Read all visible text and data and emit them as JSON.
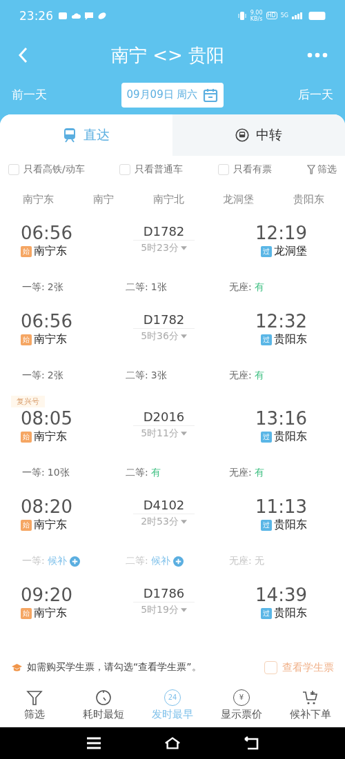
{
  "status_bar": {
    "time": "23:26",
    "speed": "9.00",
    "speed_unit": "KB/s",
    "hd": "HD",
    "network": "5G"
  },
  "header": {
    "title": "南宁 <> 贵阳",
    "prev_day": "前一天",
    "date": "09月09日 周六",
    "next_day": "后一天"
  },
  "tabs": [
    {
      "label": "直达",
      "kind": "direct",
      "selected": true
    },
    {
      "label": "中转",
      "kind": "transfer",
      "selected": false
    }
  ],
  "filters": [
    {
      "label": "只看高铁/动车",
      "checked": false
    },
    {
      "label": "只看普通车",
      "checked": false
    },
    {
      "label": "只看有票",
      "checked": false
    }
  ],
  "filter_button": "筛选",
  "stations": [
    "南宁东",
    "南宁",
    "南宁北",
    "龙洞堡",
    "贵阳东"
  ],
  "trains": [
    {
      "depart": "06:56",
      "from": {
        "badge": "始",
        "kind": "start",
        "name": "南宁东"
      },
      "number": "D1782",
      "duration": "5时23分",
      "arrive": "12:19",
      "to": {
        "badge": "过",
        "kind": "pass",
        "name": "龙洞堡"
      },
      "sold_out": false,
      "seats": [
        {
          "label": "一等:",
          "value": "2张",
          "kind": "count"
        },
        {
          "label": "二等:",
          "value": "1张",
          "kind": "count"
        },
        {
          "label": "无座:",
          "value": "有",
          "kind": "available"
        }
      ]
    },
    {
      "depart": "06:56",
      "from": {
        "badge": "始",
        "kind": "start",
        "name": "南宁东"
      },
      "number": "D1782",
      "duration": "5时36分",
      "arrive": "12:32",
      "to": {
        "badge": "过",
        "kind": "pass",
        "name": "贵阳东"
      },
      "sold_out": false,
      "seats": [
        {
          "label": "一等:",
          "value": "2张",
          "kind": "count"
        },
        {
          "label": "二等:",
          "value": "3张",
          "kind": "count"
        },
        {
          "label": "无座:",
          "value": "有",
          "kind": "available"
        }
      ]
    },
    {
      "tag": "复兴号",
      "depart": "08:05",
      "from": {
        "badge": "始",
        "kind": "start",
        "name": "南宁东"
      },
      "number": "D2016",
      "duration": "5时11分",
      "arrive": "13:16",
      "to": {
        "badge": "过",
        "kind": "pass",
        "name": "贵阳东"
      },
      "sold_out": false,
      "seats": [
        {
          "label": "一等:",
          "value": "10张",
          "kind": "count"
        },
        {
          "label": "二等:",
          "value": "有",
          "kind": "available"
        },
        {
          "label": "无座:",
          "value": "有",
          "kind": "available"
        }
      ]
    },
    {
      "depart": "08:20",
      "from": {
        "badge": "始",
        "kind": "start",
        "name": "南宁东"
      },
      "number": "D4102",
      "duration": "2时53分",
      "arrive": "11:13",
      "to": {
        "badge": "过",
        "kind": "pass",
        "name": "贵阳东"
      },
      "sold_out": true,
      "seats": [
        {
          "label": "一等:",
          "value": "候补",
          "kind": "waitlist"
        },
        {
          "label": "二等:",
          "value": "候补",
          "kind": "waitlist"
        },
        {
          "label": "无座:",
          "value": "无",
          "kind": "none"
        }
      ]
    },
    {
      "depart": "09:20",
      "from": {
        "badge": "始",
        "kind": "start",
        "name": "南宁东"
      },
      "number": "D1786",
      "duration": "5时19分",
      "arrive": "14:39",
      "to": {
        "badge": "过",
        "kind": "pass",
        "name": "贵阳东"
      }
    }
  ],
  "student_note": {
    "text": "如需购买学生票，请勾选“查看学生票”。",
    "checkbox_label": "查看学生票",
    "checked": false
  },
  "bottom_nav": [
    {
      "label": "筛选",
      "kind": "filter",
      "selected": false
    },
    {
      "label": "耗时最短",
      "kind": "timer",
      "selected": false
    },
    {
      "label": "发时最早",
      "kind": "clock24",
      "selected": true,
      "icon_text": "24"
    },
    {
      "label": "显示票价",
      "kind": "price",
      "selected": false,
      "icon_text": "¥"
    },
    {
      "label": "候补下单",
      "kind": "cart",
      "selected": false
    }
  ]
}
